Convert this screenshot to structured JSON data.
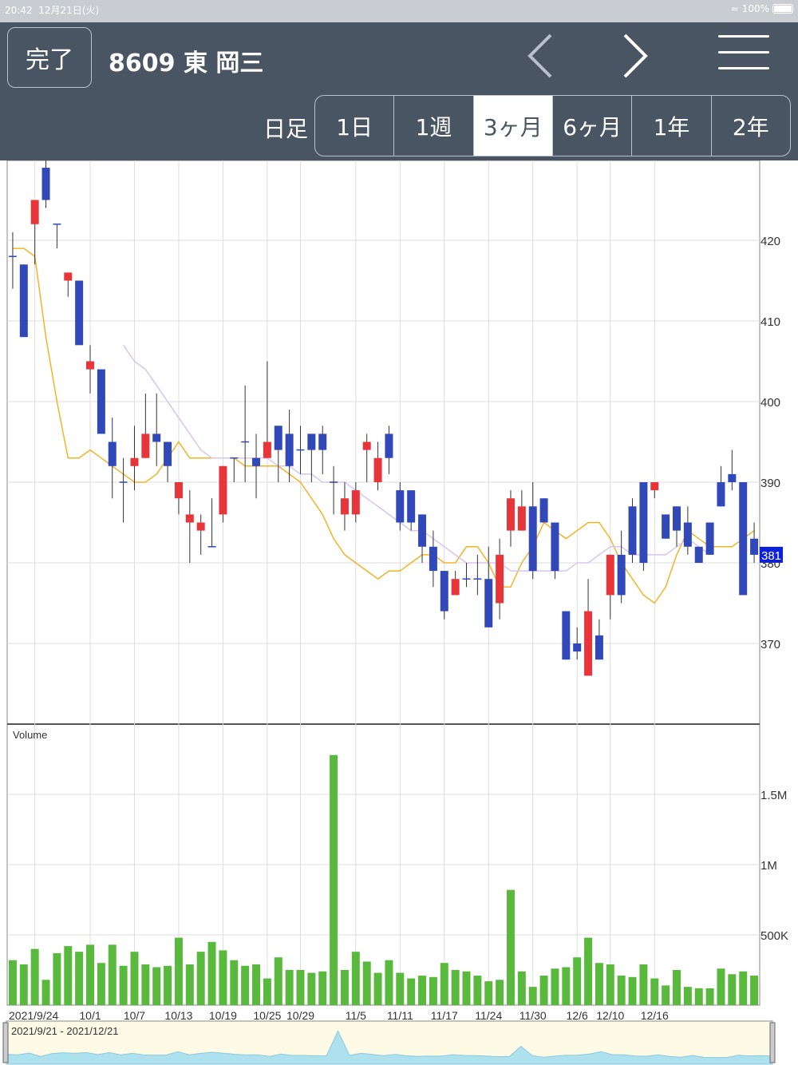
{
  "status": {
    "time": "20:42",
    "date": "12月21日(火)",
    "battery": "100%"
  },
  "header": {
    "done": "完了",
    "title": "8609 東 岡三",
    "period_label": "日足",
    "tabs": [
      "1日",
      "1週",
      "3ヶ月",
      "6ヶ月",
      "1年",
      "2年"
    ],
    "active_tab": 2
  },
  "colors": {
    "up": "#e8353a",
    "down": "#3048b8",
    "volume": "#59b93c",
    "ma1": "#f2b427",
    "ma2": "#d8c4f0",
    "header": "#4a5563"
  },
  "chart_data": [
    {
      "type": "candlestick",
      "price_ticks": [
        420,
        410,
        400,
        390,
        380,
        370
      ],
      "last_price_label": "381",
      "candles": [
        [
          418,
          418,
          421,
          414
        ],
        [
          417,
          408,
          417,
          408
        ],
        [
          422,
          425,
          425,
          417
        ],
        [
          429,
          425,
          430,
          424
        ],
        [
          422,
          422,
          422,
          419
        ],
        [
          415,
          416,
          416,
          413
        ],
        [
          415,
          407,
          415,
          407
        ],
        [
          404,
          405,
          407,
          401
        ],
        [
          404,
          396,
          404,
          396
        ],
        [
          395,
          392,
          398,
          388
        ],
        [
          390,
          390,
          393,
          385
        ],
        [
          392,
          393,
          397,
          389
        ],
        [
          393,
          396,
          401,
          393
        ],
        [
          396,
          395,
          401,
          392
        ],
        [
          395,
          392,
          395,
          390
        ],
        [
          388,
          390,
          390,
          386
        ],
        [
          385,
          386,
          389,
          380
        ],
        [
          384,
          385,
          386,
          381
        ],
        [
          382,
          382,
          388,
          382
        ],
        [
          386,
          392,
          392,
          385
        ],
        [
          393,
          393,
          393,
          390
        ],
        [
          395,
          395,
          402,
          390
        ],
        [
          393,
          392,
          396,
          388
        ],
        [
          393,
          395,
          405,
          393
        ],
        [
          397,
          394,
          397,
          390
        ],
        [
          396,
          392,
          399,
          390
        ],
        [
          394,
          394,
          397,
          391
        ],
        [
          396,
          394,
          396,
          390
        ],
        [
          396,
          394,
          397,
          391
        ],
        [
          390,
          390,
          392,
          386
        ],
        [
          386,
          388,
          390,
          384
        ],
        [
          386,
          389,
          390,
          385
        ],
        [
          394,
          395,
          396,
          390
        ],
        [
          390,
          393,
          395,
          389
        ],
        [
          396,
          393,
          397,
          391
        ],
        [
          389,
          385,
          390,
          384
        ],
        [
          389,
          385,
          389,
          384
        ],
        [
          386,
          382,
          386,
          380
        ],
        [
          382,
          379,
          384,
          377
        ],
        [
          379,
          374,
          379,
          373
        ],
        [
          376,
          378,
          379,
          376
        ],
        [
          378,
          378,
          380,
          377
        ],
        [
          378,
          378,
          381,
          376
        ],
        [
          378,
          372,
          382,
          372
        ],
        [
          375,
          381,
          383,
          373
        ],
        [
          384,
          388,
          389,
          382
        ],
        [
          384,
          387,
          389,
          384
        ],
        [
          387,
          379,
          390,
          378
        ],
        [
          388,
          385,
          388,
          385
        ],
        [
          385,
          379,
          385,
          378
        ],
        [
          374,
          368,
          374,
          368
        ],
        [
          370,
          369,
          372,
          368
        ],
        [
          366,
          374,
          378,
          366
        ],
        [
          371,
          368,
          373,
          368
        ],
        [
          376,
          381,
          381,
          373
        ],
        [
          381,
          376,
          384,
          375
        ],
        [
          387,
          381,
          388,
          380
        ],
        [
          390,
          380,
          390,
          379
        ],
        [
          389,
          390,
          389,
          388
        ],
        [
          386,
          383,
          386,
          383
        ],
        [
          387,
          384,
          387,
          382
        ],
        [
          385,
          382,
          387,
          381
        ],
        [
          382,
          380,
          382,
          380
        ],
        [
          385,
          381,
          385,
          381
        ],
        [
          390,
          387,
          392,
          387
        ],
        [
          391,
          390,
          394,
          389
        ],
        [
          390,
          376,
          390,
          376
        ],
        [
          383,
          381,
          385,
          380
        ]
      ],
      "ma_short": [
        419,
        419,
        418,
        408,
        400,
        393,
        393,
        394,
        393,
        392,
        391,
        390,
        390,
        391,
        393,
        395,
        393,
        393,
        393,
        393,
        393,
        392,
        392,
        392,
        392,
        391,
        390,
        388,
        386,
        383,
        381,
        380,
        379,
        378,
        379,
        379,
        380,
        381,
        381,
        380,
        380,
        382,
        382,
        380,
        377,
        377,
        380,
        382,
        385,
        384,
        383,
        384,
        385,
        385,
        383,
        380,
        378,
        376,
        375,
        377,
        381,
        384,
        383,
        382,
        382,
        382,
        383,
        384
      ],
      "ma_long": [
        407,
        405,
        404,
        402,
        400,
        398,
        396,
        394,
        393,
        393,
        393,
        393,
        393,
        393,
        392,
        392,
        391,
        391,
        390,
        390,
        390,
        389,
        388,
        387,
        386,
        385,
        384,
        384,
        383,
        382,
        381,
        380,
        380,
        380,
        380,
        379,
        379,
        379,
        379,
        379,
        379,
        380,
        380,
        381,
        382,
        382,
        381,
        381,
        381,
        381,
        382,
        383,
        382,
        381
      ],
      "ma_long_start": 10,
      "volume_ticks": [
        1500000,
        1000000,
        500000
      ],
      "volume_tick_labels": [
        "1.5M",
        "1M",
        "500K"
      ],
      "volume_label": "Volume",
      "volumes": [
        320000,
        290000,
        400000,
        180000,
        370000,
        420000,
        380000,
        430000,
        300000,
        430000,
        280000,
        380000,
        290000,
        270000,
        280000,
        480000,
        290000,
        380000,
        450000,
        390000,
        320000,
        280000,
        290000,
        190000,
        340000,
        250000,
        250000,
        230000,
        240000,
        1780000,
        250000,
        380000,
        310000,
        230000,
        320000,
        230000,
        190000,
        210000,
        200000,
        300000,
        250000,
        240000,
        210000,
        170000,
        180000,
        820000,
        240000,
        130000,
        210000,
        260000,
        270000,
        340000,
        480000,
        300000,
        290000,
        210000,
        200000,
        290000,
        190000,
        140000,
        250000,
        130000,
        120000,
        120000,
        260000,
        220000,
        240000,
        210000
      ],
      "x_labels": [
        "2021/9/24",
        "10/1",
        "10/7",
        "10/13",
        "10/19",
        "10/25",
        "10/29",
        "11/5",
        "11/11",
        "11/17",
        "11/24",
        "11/30",
        "12/6",
        "12/10",
        "12/16"
      ],
      "range_label": "2021/9/21 - 2021/12/21"
    }
  ]
}
